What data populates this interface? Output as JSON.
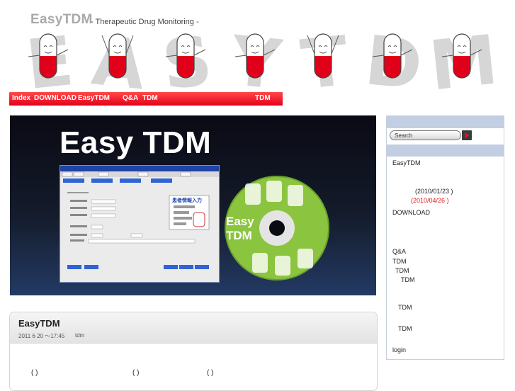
{
  "header": {
    "site_title": "EasyTDM",
    "subtitle": "- Therapeutic Drug Monitoring -",
    "letters": [
      "E",
      "A",
      "S",
      "Y",
      "T",
      "D",
      "M"
    ]
  },
  "nav": {
    "items": [
      "Index",
      "DOWNLOAD",
      "EasyTDM",
      "Q&A",
      "TDM",
      "TDM"
    ]
  },
  "hero": {
    "title": "Easy TDM",
    "disc_text_line1": "Easy",
    "disc_text_line2": "TDM",
    "app_heading": "患者情報入力"
  },
  "post": {
    "title": "EasyTDM",
    "date": "2011 6 20 ～17:45",
    "author": "tdm",
    "parens": [
      "(        )",
      "(        )",
      "(        )"
    ]
  },
  "sidebar": {
    "search_placeholder": "Search",
    "links": {
      "easytdm": "EasyTDM",
      "date1": "(2010/01/23 )",
      "date2": "(2010/04/26 )",
      "download": "DOWNLOAD",
      "qa": "Q&A",
      "tdm1": "TDM",
      "tdm2": "TDM",
      "tdm3": "TDM",
      "tdm4": "TDM",
      "tdm5": "TDM",
      "login": "login"
    }
  },
  "colors": {
    "nav_red": "#e4001a",
    "title_gray": "#a9a9a9",
    "sidebar_band": "#c2cfe3",
    "pill_red": "#e0001a",
    "disc_green": "#8bc43f"
  }
}
